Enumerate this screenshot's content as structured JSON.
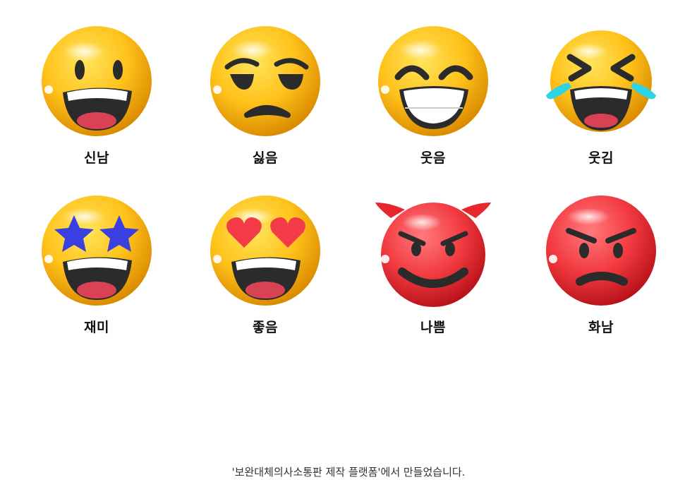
{
  "emojis": [
    {
      "label": "신남",
      "icon": "grinning-face-icon"
    },
    {
      "label": "싫음",
      "icon": "unamused-face-icon"
    },
    {
      "label": "웃음",
      "icon": "beaming-face-icon"
    },
    {
      "label": "웃김",
      "icon": "tears-of-joy-face-icon"
    },
    {
      "label": "재미",
      "icon": "star-struck-face-icon"
    },
    {
      "label": "좋음",
      "icon": "heart-eyes-face-icon"
    },
    {
      "label": "나쁨",
      "icon": "smiling-devil-face-icon"
    },
    {
      "label": "화남",
      "icon": "angry-face-icon"
    }
  ],
  "footer": {
    "credit": "'보완대체의사소통판 제작 플랫폼'에서 만들었습니다."
  },
  "colors": {
    "yellow_light": "#FFD22E",
    "yellow_dark": "#E89A05",
    "red_light": "#FF5A5E",
    "red_dark": "#C8141E",
    "feature_dark": "#2B2B2B",
    "tongue": "#D94155",
    "tear": "#2ED3E6",
    "star": "#3A3FE0",
    "heart": "#F23A48"
  }
}
